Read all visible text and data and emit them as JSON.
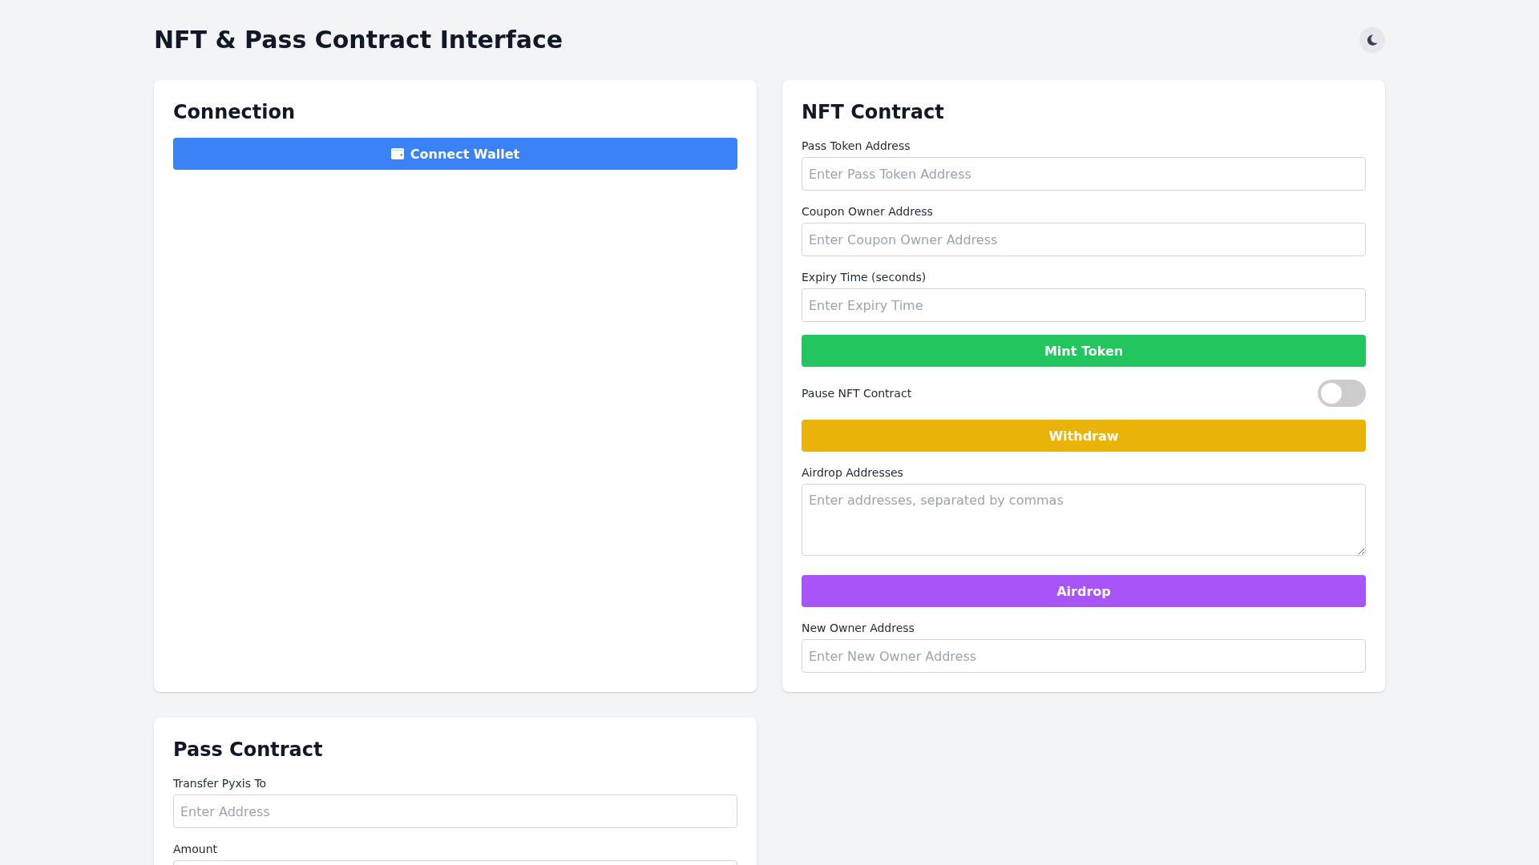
{
  "header": {
    "title": "NFT & Pass Contract Interface"
  },
  "cards": [
    {
      "title": "Connection",
      "items": [
        {
          "kind": "connect",
          "label": "Connect Wallet",
          "color": "#3b82f6"
        }
      ]
    },
    {
      "title": "NFT Contract",
      "items": [
        {
          "kind": "field",
          "label": "Pass Token Address",
          "placeholder": "Enter Pass Token Address"
        },
        {
          "kind": "field",
          "label": "Coupon Owner Address",
          "placeholder": "Enter Coupon Owner Address"
        },
        {
          "kind": "field",
          "label": "Expiry Time (seconds)",
          "placeholder": "Enter Expiry Time"
        },
        {
          "kind": "button",
          "label": "Mint Token",
          "color": "#22c55e"
        },
        {
          "kind": "toggle",
          "label": "Pause NFT Contract",
          "on": false
        },
        {
          "kind": "button",
          "label": "Withdraw",
          "color": "#eab308"
        },
        {
          "kind": "textarea",
          "label": "Airdrop Addresses",
          "placeholder": "Enter addresses, separated by commas"
        },
        {
          "kind": "button",
          "label": "Airdrop",
          "color": "#a855f7"
        },
        {
          "kind": "field",
          "label": "New Owner Address",
          "placeholder": "Enter New Owner Address"
        }
      ]
    },
    {
      "title": "Pass Contract",
      "items": [
        {
          "kind": "field",
          "label": "Transfer Pyxis To",
          "placeholder": "Enter Address"
        },
        {
          "kind": "field",
          "label": "Amount"
        }
      ]
    }
  ]
}
